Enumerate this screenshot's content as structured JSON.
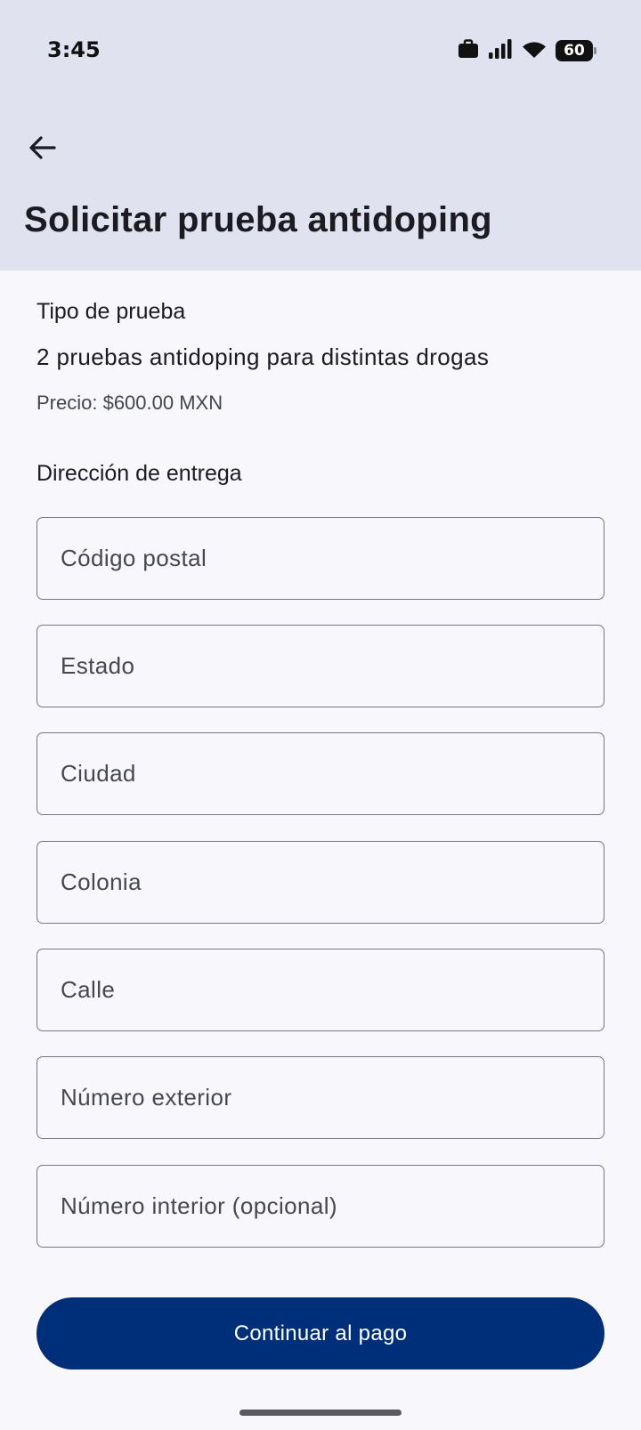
{
  "status_bar": {
    "time": "3:45",
    "battery_level": "60",
    "icons": [
      "briefcase-icon",
      "signal-icon",
      "wifi-icon",
      "battery-icon"
    ]
  },
  "header": {
    "title": "Solicitar prueba antidoping",
    "back_icon": "arrow-left-icon"
  },
  "test": {
    "section_label": "Tipo de prueba",
    "name": "2 pruebas antidoping para distintas drogas",
    "price": "Precio: $600.00 MXN"
  },
  "address": {
    "section_label": "Dirección de entrega",
    "fields": {
      "postal_code": {
        "placeholder": "Código postal",
        "value": ""
      },
      "state": {
        "placeholder": "Estado",
        "value": ""
      },
      "city": {
        "placeholder": "Ciudad",
        "value": ""
      },
      "neighborhood": {
        "placeholder": "Colonia",
        "value": ""
      },
      "street": {
        "placeholder": "Calle",
        "value": ""
      },
      "exterior_number": {
        "placeholder": "Número exterior",
        "value": ""
      },
      "interior_number": {
        "placeholder": "Número interior (opcional)",
        "value": ""
      }
    }
  },
  "actions": {
    "continue_label": "Continuar al pago"
  },
  "colors": {
    "header_bg": "#e0e2ef",
    "page_bg": "#f7f7fc",
    "primary": "#002f7a"
  }
}
